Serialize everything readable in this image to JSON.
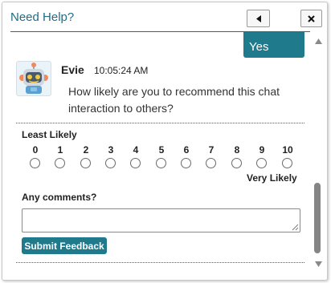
{
  "header": {
    "title": "Need Help?"
  },
  "conversation": {
    "user_message": "Yes",
    "bot": {
      "name": "Evie",
      "time": "10:05:24 AM",
      "message": "How likely are you to recommend this chat interaction to others?"
    }
  },
  "survey": {
    "least_label": "Least Likely",
    "most_label": "Very Likely",
    "scale": [
      "0",
      "1",
      "2",
      "3",
      "4",
      "5",
      "6",
      "7",
      "8",
      "9",
      "10"
    ],
    "comments_label": "Any comments?",
    "comments_value": "",
    "submit_label": "Submit Feedback"
  },
  "colors": {
    "accent": "#1f7a8c",
    "title": "#1f6d88"
  },
  "icons": {
    "minimize": "triangle-left-icon",
    "close": "close-icon",
    "scroll_up": "triangle-up-icon",
    "scroll_down": "triangle-down-icon",
    "avatar": "robot-avatar"
  }
}
